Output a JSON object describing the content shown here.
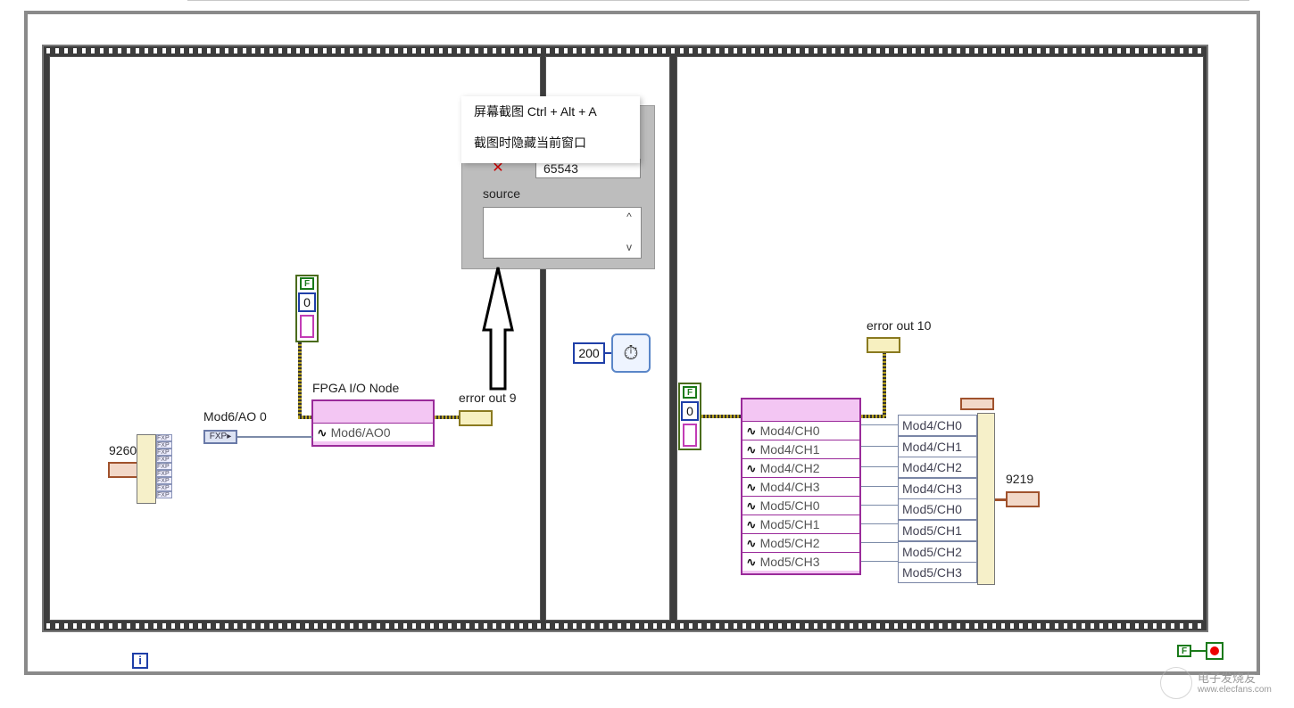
{
  "context_menu": {
    "items": [
      "屏幕截图 Ctrl + Alt + A",
      "截图时隐藏当前窗口"
    ]
  },
  "error_panel": {
    "code_value": "65543",
    "source_label": "source",
    "source_value": ""
  },
  "frame1": {
    "bool_constant": "F",
    "numeric_constant": "0",
    "io_node_label": "FPGA I/O Node",
    "io_node_item": "Mod6/AO0",
    "error_label": "error out 9",
    "mod_label": "Mod6/AO 0",
    "cluster_label": "9260",
    "fxp_tags": [
      "FXP",
      "FXP",
      "FXP",
      "FXP",
      "FXP",
      "FXP",
      "FXP",
      "FXP",
      "FXP"
    ]
  },
  "frame2": {
    "wait_value": "200"
  },
  "frame3": {
    "bool_constant": "F",
    "numeric_constant": "0",
    "error_label": "error out 10",
    "io_items": [
      "Mod4/CH0",
      "Mod4/CH1",
      "Mod4/CH2",
      "Mod4/CH3",
      "Mod5/CH0",
      "Mod5/CH1",
      "Mod5/CH2",
      "Mod5/CH3"
    ],
    "indicators": [
      "Mod4/CH0",
      "Mod4/CH1",
      "Mod4/CH2",
      "Mod4/CH3",
      "Mod5/CH0",
      "Mod5/CH1",
      "Mod5/CH2",
      "Mod5/CH3"
    ],
    "cluster_label": "9219"
  },
  "loop": {
    "iteration_label": "i",
    "stop_bool": "F"
  },
  "watermark": {
    "text_cn": "电子发烧友",
    "text_url": "www.elecfans.com"
  }
}
